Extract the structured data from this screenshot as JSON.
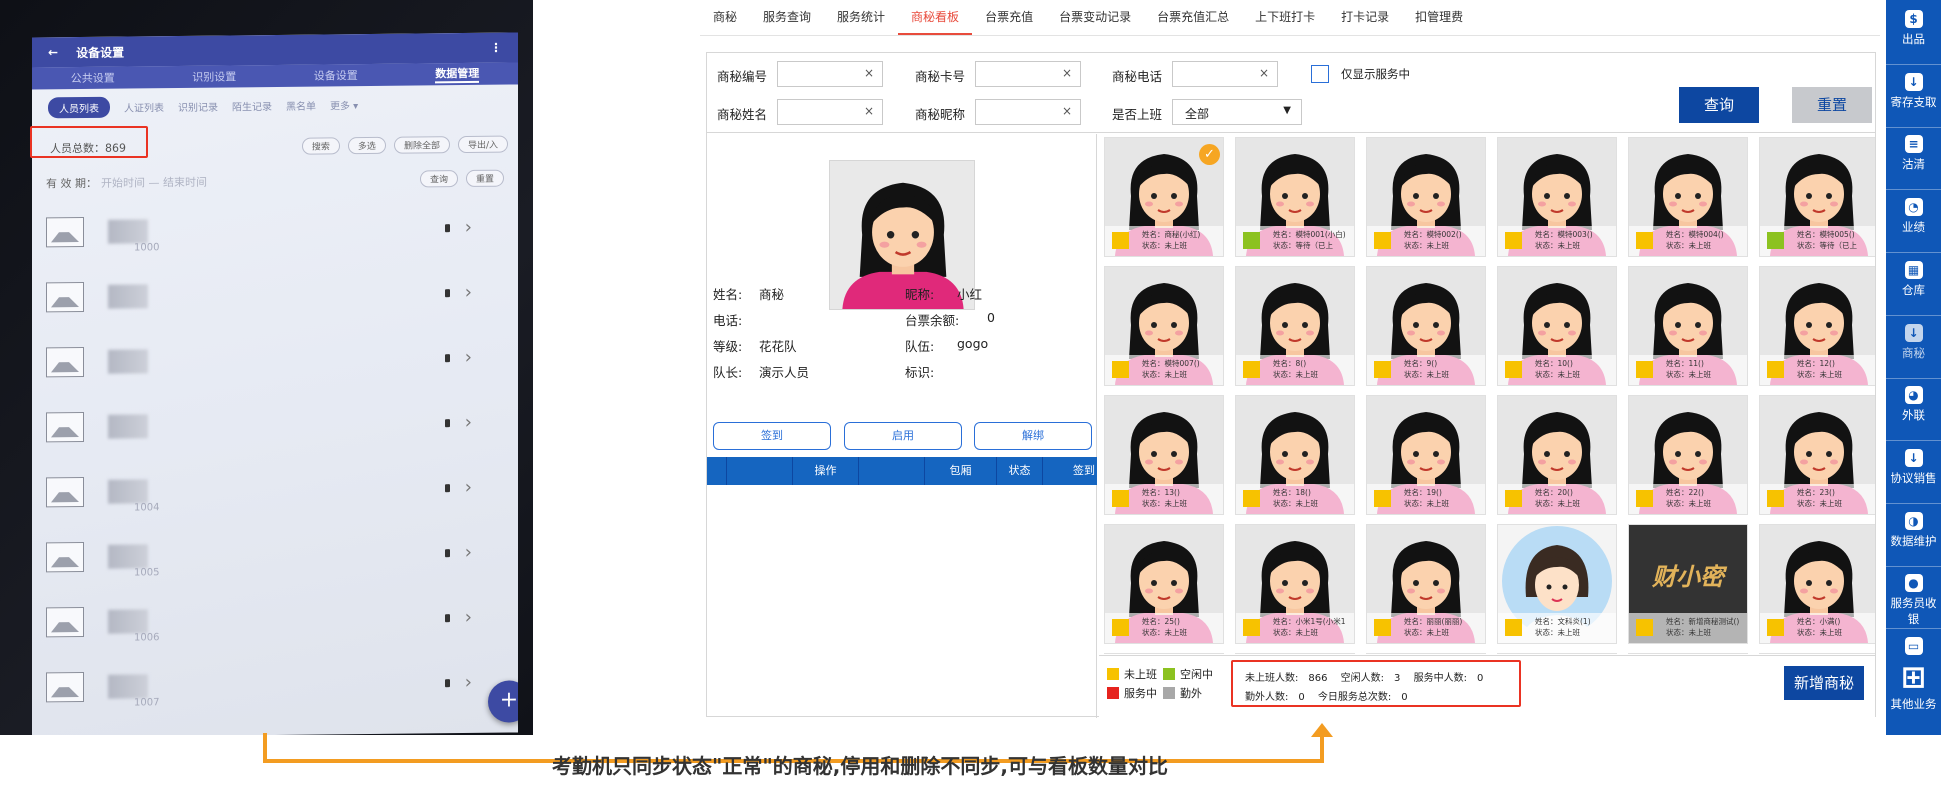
{
  "phone": {
    "title": "设备设置",
    "back": "←",
    "menu": "⋮",
    "tabs": [
      "公共设置",
      "识别设置",
      "设备设置",
      "数据管理"
    ],
    "subtabs": [
      "人员列表",
      "人证列表",
      "识别记录",
      "陌生记录",
      "黑名单",
      "更多 ▾"
    ],
    "total": "人员总数：869",
    "buttons": [
      "搜索",
      "多选",
      "删除全部",
      "导出/入"
    ],
    "valid_label": "有 效 期：",
    "valid_placeholder": "开始时间 — 结束时间",
    "valid_buttons": [
      "查询",
      "重置"
    ],
    "rows": [
      "1000",
      "",
      "",
      "",
      "1004",
      "1005",
      "1006",
      "1007"
    ],
    "fab": "+"
  },
  "nav": {
    "items": [
      "商秘",
      "服务查询",
      "服务统计",
      "商秘看板",
      "台票充值",
      "台票变动记录",
      "台票充值汇总",
      "上下班打卡",
      "打卡记录",
      "扣管理费"
    ],
    "active": "商秘看板"
  },
  "search": {
    "code_label": "商秘编号",
    "card_label": "商秘卡号",
    "phone_label": "商秘电话",
    "only_service_label": "仅显示服务中",
    "name_label": "商秘姓名",
    "nick_label": "商秘昵称",
    "onduty_label": "是否上班",
    "onduty_value": "全部",
    "clear": "×",
    "query_button": "查询",
    "reset_button": "重置"
  },
  "detail": {
    "name_label": "姓名:",
    "name_value": "商秘",
    "nick_label": "昵称:",
    "nick_value": "小红",
    "phone_label": "电话:",
    "phone_value": "",
    "balance_label": "台票余额:",
    "balance_value": "0",
    "level_label": "等级:",
    "level_value": "花花队",
    "team_label": "队伍:",
    "team_value": "gogo",
    "captain_label": "队长:",
    "captain_value": "演示人员",
    "tag_label": "标识:",
    "tag_value": "",
    "buttons": [
      "签到",
      "启用",
      "解绑"
    ],
    "table_headers": [
      "",
      "",
      "操作",
      "",
      "包厢",
      "状态",
      "签到"
    ]
  },
  "cards": [
    {
      "name": "姓名：商秘(小红)",
      "status": "状态：未上班",
      "color": "#f7c200",
      "checked": true,
      "img": "girl"
    },
    {
      "name": "姓名：模特001(小白)",
      "status": "状态：等待（已上",
      "color": "#8cc220",
      "checked": false,
      "img": "girl"
    },
    {
      "name": "姓名：模特002()",
      "status": "状态：未上班",
      "color": "#f7c200",
      "checked": false,
      "img": "girl"
    },
    {
      "name": "姓名：模特003()",
      "status": "状态：未上班",
      "color": "#f7c200",
      "checked": false,
      "img": "girl"
    },
    {
      "name": "姓名：模特004()",
      "status": "状态：未上班",
      "color": "#f7c200",
      "checked": false,
      "img": "girl"
    },
    {
      "name": "姓名：模特005()",
      "status": "状态：等待（已上",
      "color": "#8cc220",
      "checked": false,
      "img": "girl"
    },
    {
      "name": "姓名：模特007()",
      "status": "状态：未上班",
      "color": "#f7c200",
      "checked": false,
      "img": "girl"
    },
    {
      "name": "姓名：8()",
      "status": "状态：未上班",
      "color": "#f7c200",
      "checked": false,
      "img": "girl"
    },
    {
      "name": "姓名：9()",
      "status": "状态：未上班",
      "color": "#f7c200",
      "checked": false,
      "img": "girl"
    },
    {
      "name": "姓名：10()",
      "status": "状态：未上班",
      "color": "#f7c200",
      "checked": false,
      "img": "girl"
    },
    {
      "name": "姓名：11()",
      "status": "状态：未上班",
      "color": "#f7c200",
      "checked": false,
      "img": "girl"
    },
    {
      "name": "姓名：12()",
      "status": "状态：未上班",
      "color": "#f7c200",
      "checked": false,
      "img": "girl"
    },
    {
      "name": "姓名：13()",
      "status": "状态：未上班",
      "color": "#f7c200",
      "checked": false,
      "img": "girl"
    },
    {
      "name": "姓名：18()",
      "status": "状态：未上班",
      "color": "#f7c200",
      "checked": false,
      "img": "girl"
    },
    {
      "name": "姓名：19()",
      "status": "状态：未上班",
      "color": "#f7c200",
      "checked": false,
      "img": "girl"
    },
    {
      "name": "姓名：20()",
      "status": "状态：未上班",
      "color": "#f7c200",
      "checked": false,
      "img": "girl"
    },
    {
      "name": "姓名：22()",
      "status": "状态：未上班",
      "color": "#f7c200",
      "checked": false,
      "img": "girl"
    },
    {
      "name": "姓名：23()",
      "status": "状态：未上班",
      "color": "#f7c200",
      "checked": false,
      "img": "girl"
    },
    {
      "name": "姓名：25()",
      "status": "状态：未上班",
      "color": "#f7c200",
      "checked": false,
      "img": "girl"
    },
    {
      "name": "姓名：小米1号(小米1",
      "status": "状态：未上班",
      "color": "#f7c200",
      "checked": false,
      "img": "girl"
    },
    {
      "name": "姓名：丽丽(丽丽)",
      "status": "状态：未上班",
      "color": "#f7c200",
      "checked": false,
      "img": "girl"
    },
    {
      "name": "姓名：文科炎(1)",
      "status": "状态：未上班",
      "color": "#f7c200",
      "checked": false,
      "img": "avatar"
    },
    {
      "name": "姓名：新增商秘测试()",
      "status": "状态：未上班",
      "color": "#f7c200",
      "checked": false,
      "img": "logo",
      "logo_text": "财小密"
    },
    {
      "name": "姓名：小满()",
      "status": "状态：未上班",
      "color": "#f7c200",
      "checked": false,
      "img": "girl"
    }
  ],
  "legend": [
    {
      "label": "未上班",
      "color": "#f7c200"
    },
    {
      "label": "空闲中",
      "color": "#8cc220"
    },
    {
      "label": "服务中",
      "color": "#e6231e"
    },
    {
      "label": "勤外",
      "color": "#a8a8a8"
    }
  ],
  "stats": {
    "offduty": "未上班人数:　866",
    "idle": "空闲人数:　3",
    "inservice": "服务中人数:　0",
    "outside": "勤外人数:　0",
    "today_total": "今日服务总次数:　0"
  },
  "add_button": "新增商秘",
  "sidebar": {
    "items": [
      {
        "label": "出品",
        "icon": "$"
      },
      {
        "label": "寄存支取",
        "icon": "↓"
      },
      {
        "label": "沽清",
        "icon": "≡"
      },
      {
        "label": "业绩",
        "icon": "◔"
      },
      {
        "label": "仓库",
        "icon": "▦"
      },
      {
        "label": "商秘",
        "icon": "↓"
      },
      {
        "label": "外联",
        "icon": "◕"
      },
      {
        "label": "协议销售",
        "icon": "↓"
      },
      {
        "label": "数据维护",
        "icon": "◑"
      },
      {
        "label": "服务员收银",
        "icon": "●"
      },
      {
        "label": "",
        "icon": "▭"
      },
      {
        "label": "其他业务",
        "icon": "⊞"
      }
    ]
  },
  "annotation": "考勤机只同步状态\"正常\"的商秘,停用和删除不同步,可与看板数量对比"
}
